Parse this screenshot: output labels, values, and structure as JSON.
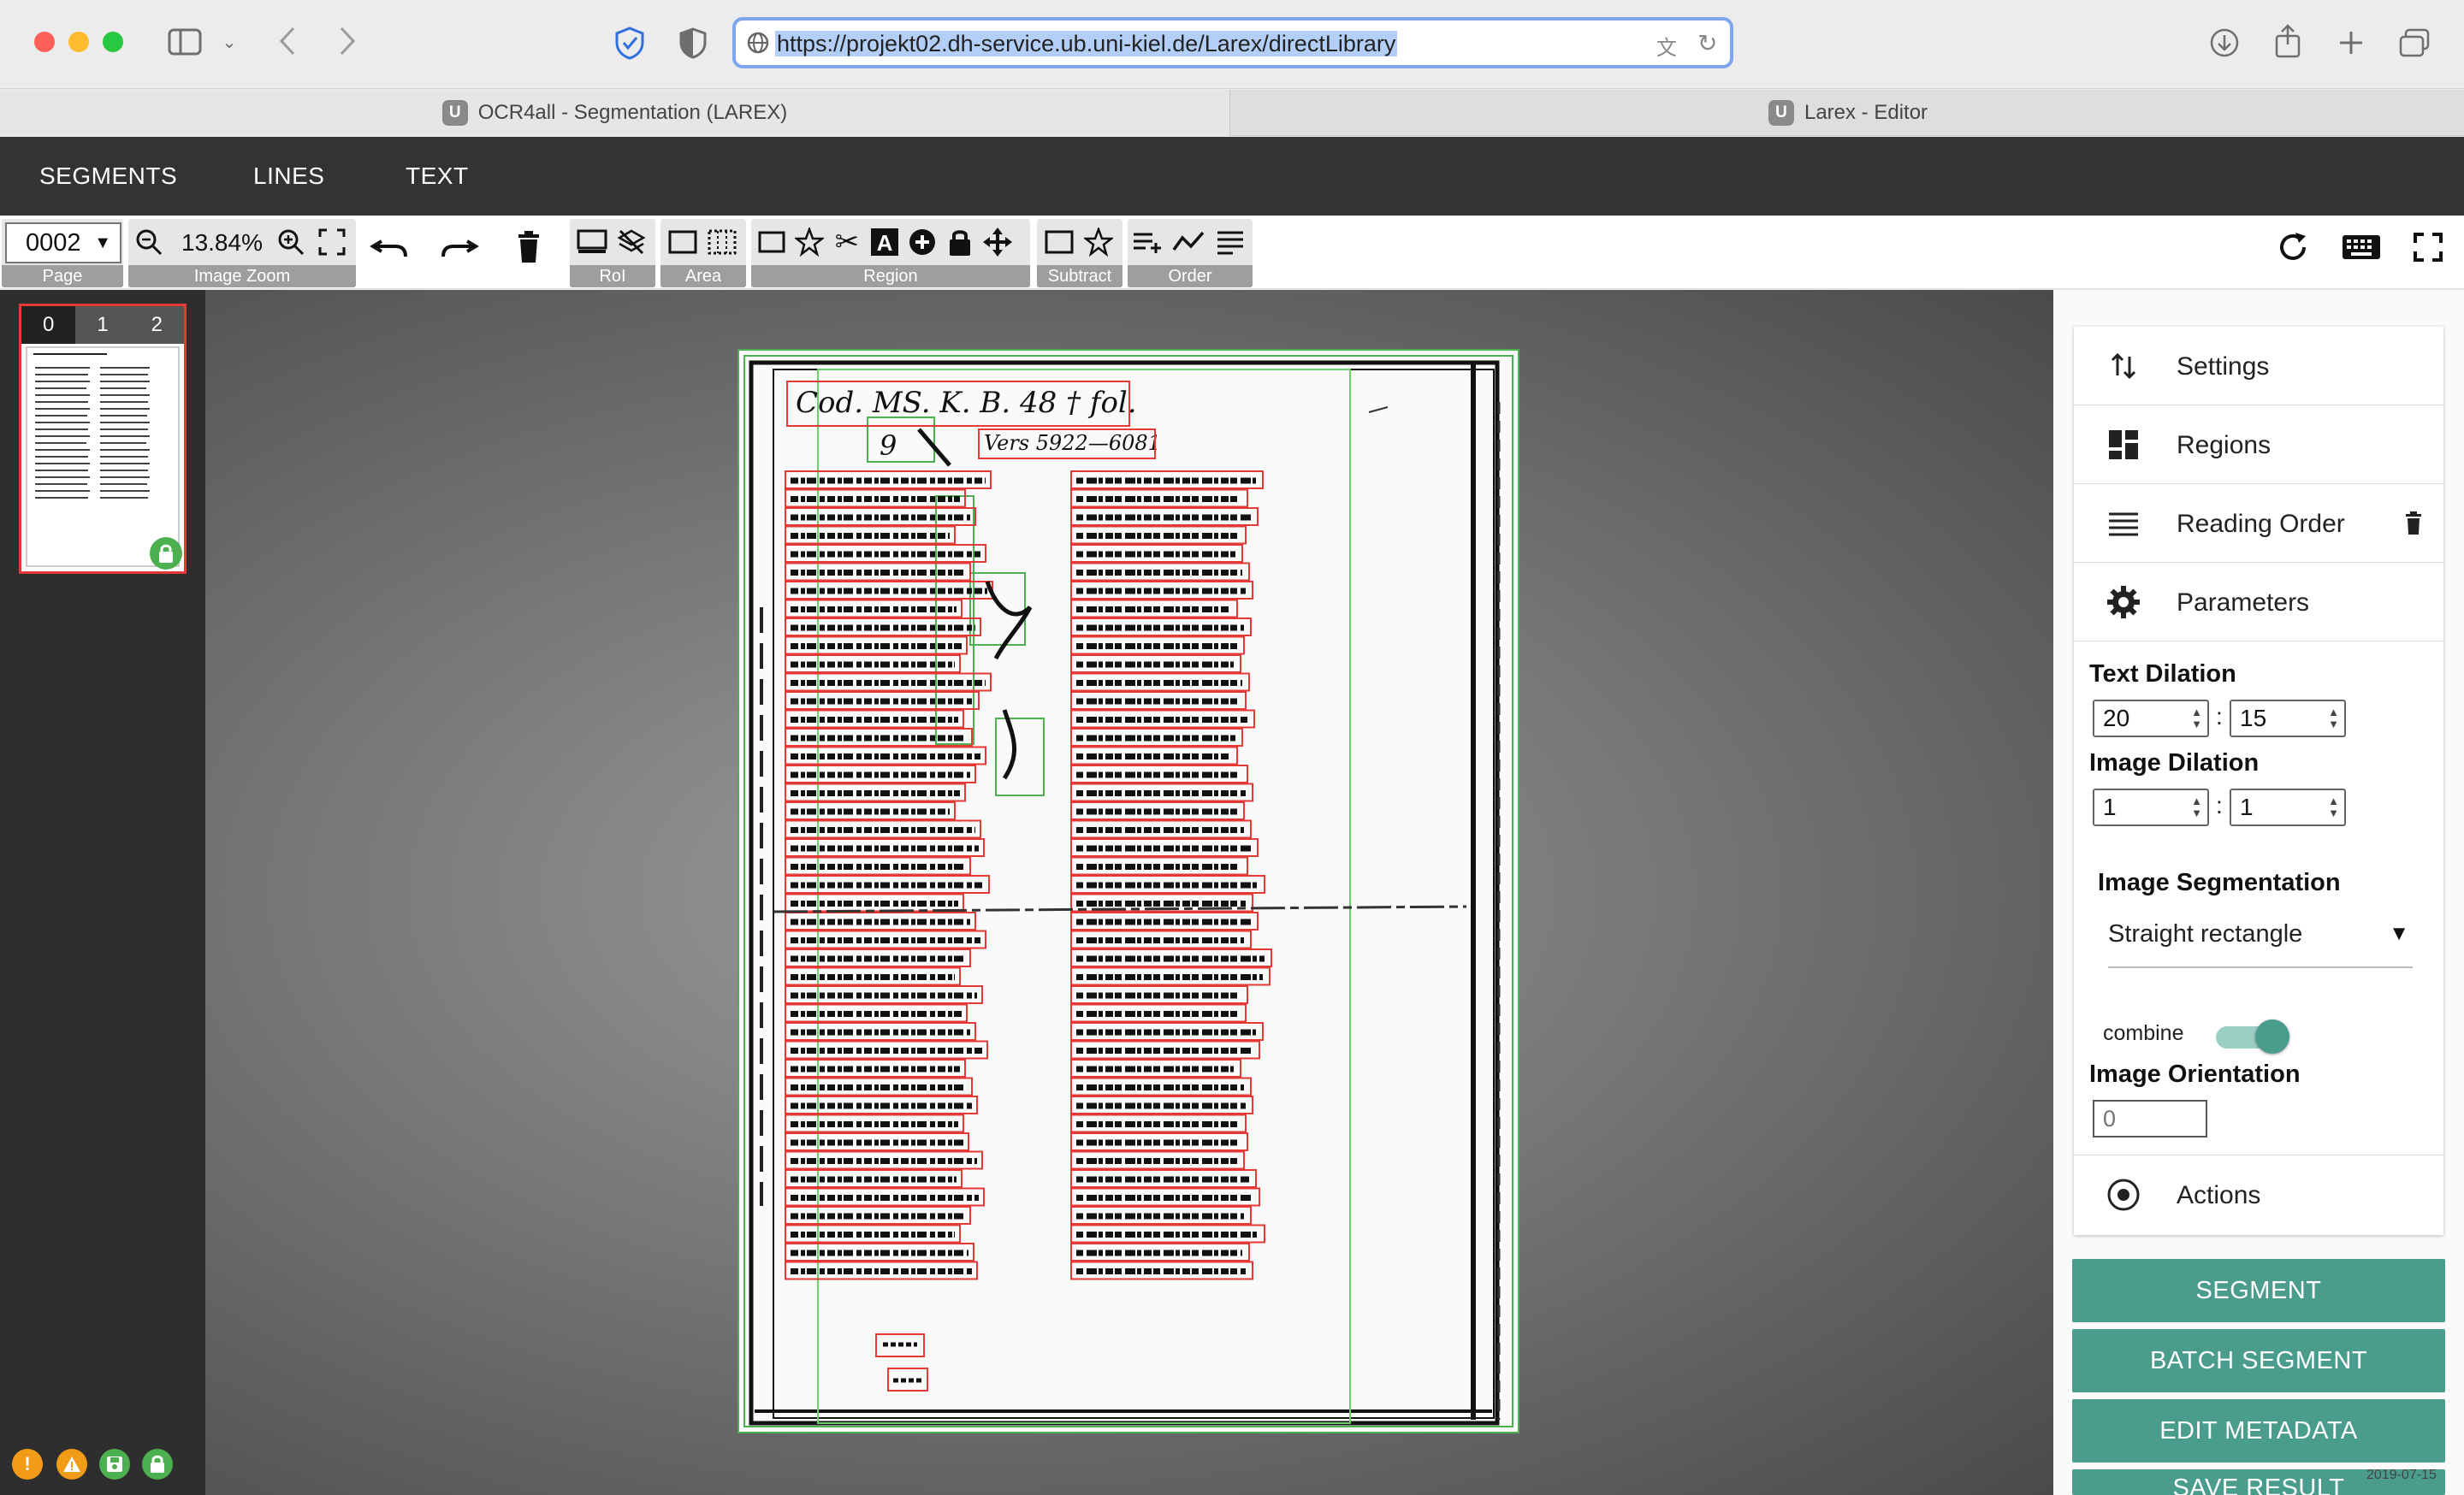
{
  "browser": {
    "url": "https://projekt02.dh-service.ub.uni-kiel.de/Larex/directLibrary",
    "tabs": [
      {
        "favicon": "U",
        "title": "OCR4all - Segmentation (LAREX)"
      },
      {
        "favicon": "U",
        "title": "Larex - Editor"
      }
    ]
  },
  "menu": {
    "items": [
      "SEGMENTS",
      "LINES",
      "TEXT"
    ]
  },
  "toolbar": {
    "page_value": "0002",
    "page_label": "Page",
    "zoom_value": "13.84%",
    "zoom_label": "Image Zoom",
    "roi_label": "RoI",
    "area_label": "Area",
    "region_label": "Region",
    "subtract_label": "Subtract",
    "order_label": "Order",
    "icons": {
      "undo": "undo-icon",
      "redo": "redo-icon",
      "delete": "trash-icon",
      "refresh": "refresh-icon",
      "keyboard": "keyboard-icon",
      "fullscreen": "fullscreen-icon"
    }
  },
  "thumbnails": {
    "tabs": [
      "0",
      "1",
      "2"
    ],
    "active_tab": "0"
  },
  "document": {
    "heading": "Cod. MS. K. B. 48 † fol.",
    "number": "9",
    "annotation": "Vers 5922—6081"
  },
  "sidebar": {
    "sections": [
      {
        "icon": "sort-icon",
        "label": "Settings"
      },
      {
        "icon": "dashboard-icon",
        "label": "Regions"
      },
      {
        "icon": "list-icon",
        "label": "Reading Order"
      },
      {
        "icon": "gear-icon",
        "label": "Parameters"
      }
    ],
    "text_dilation": {
      "label": "Text Dilation",
      "x": "20",
      "y": "15"
    },
    "image_dilation": {
      "label": "Image Dilation",
      "x": "1",
      "y": "1"
    },
    "image_segmentation": {
      "label": "Image Segmentation",
      "value": "Straight rectangle"
    },
    "combine": {
      "label": "combine",
      "enabled": true
    },
    "image_orientation": {
      "label": "Image Orientation",
      "placeholder": "0"
    },
    "actions_label": "Actions"
  },
  "buttons": {
    "segment": "SEGMENT",
    "batch_segment": "BATCH SEGMENT",
    "edit_metadata": "EDIT METADATA",
    "save_result": "SAVE RESULT"
  },
  "footer": {
    "date": "2019-07-15"
  },
  "colors": {
    "accent": "#4a9c8c",
    "menubar": "#333333",
    "region_text": "#e53935",
    "region_image": "#4caf50"
  }
}
